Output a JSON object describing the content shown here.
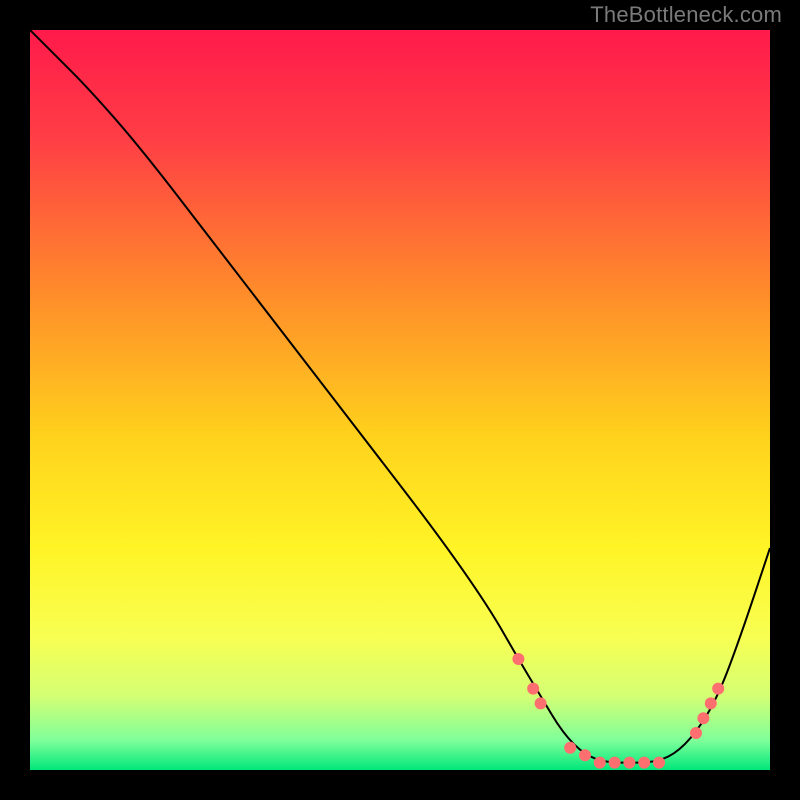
{
  "watermark": "TheBottleneck.com",
  "chart_data": {
    "type": "line",
    "title": "",
    "xlabel": "",
    "ylabel": "",
    "xlim": [
      0,
      100
    ],
    "ylim": [
      0,
      100
    ],
    "grid": false,
    "legend": false,
    "background_gradient": {
      "type": "vertical",
      "stops": [
        {
          "pos": 0.0,
          "color": "#ff1a4b"
        },
        {
          "pos": 0.15,
          "color": "#ff3f45"
        },
        {
          "pos": 0.35,
          "color": "#ff8a2b"
        },
        {
          "pos": 0.55,
          "color": "#ffd21c"
        },
        {
          "pos": 0.7,
          "color": "#fff426"
        },
        {
          "pos": 0.82,
          "color": "#f8ff52"
        },
        {
          "pos": 0.9,
          "color": "#d4ff74"
        },
        {
          "pos": 0.96,
          "color": "#7fff9a"
        },
        {
          "pos": 1.0,
          "color": "#00e77a"
        }
      ]
    },
    "series": [
      {
        "name": "curve",
        "color": "#000000",
        "stroke_width": 2,
        "x": [
          0,
          3,
          8,
          15,
          25,
          35,
          45,
          55,
          62,
          66,
          69,
          72,
          75,
          78,
          81,
          84,
          87,
          90,
          93,
          96,
          100
        ],
        "y": [
          100,
          97,
          92,
          84,
          71,
          58,
          45,
          32,
          22,
          15,
          10,
          5,
          2,
          1,
          1,
          1,
          2,
          5,
          10,
          18,
          30
        ]
      }
    ],
    "markers": [
      {
        "name": "dots",
        "color": "#ff6f6f",
        "radius": 6,
        "x": [
          66,
          68,
          69,
          73,
          75,
          77,
          79,
          81,
          83,
          85,
          90,
          91,
          92,
          93
        ],
        "y": [
          15,
          11,
          9,
          3,
          2,
          1,
          1,
          1,
          1,
          1,
          5,
          7,
          9,
          11
        ]
      }
    ]
  }
}
